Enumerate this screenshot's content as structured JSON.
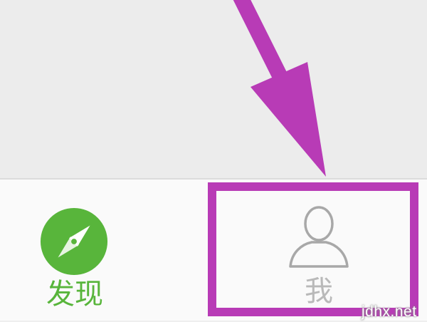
{
  "tabbar": {
    "items": [
      {
        "label": "发现",
        "icon": "compass-icon",
        "color": "#58b53b",
        "selected": false
      },
      {
        "label": "我",
        "icon": "person-icon",
        "color": "#b9b9b9",
        "selected": false
      }
    ]
  },
  "annotation": {
    "highlight_color": "#b83bb6",
    "arrow_color": "#b83bb6",
    "target": "tab-me"
  },
  "watermark": {
    "text": "jdhx.net"
  }
}
